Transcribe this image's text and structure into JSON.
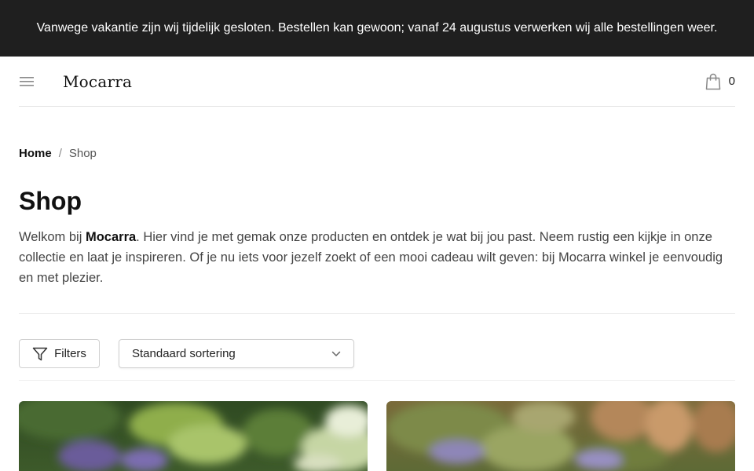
{
  "notice": {
    "text": "Vanwege vakantie zijn wij tijdelijk gesloten. Bestellen kan gewoon; vanaf 24 augustus verwerken wij alle bestellingen weer."
  },
  "header": {
    "logo": "Mocarra",
    "menu_icon": "hamburger-menu-icon",
    "cart_icon": "shopping-bag-icon",
    "cart_count": "0"
  },
  "breadcrumb": {
    "home": "Home",
    "separator": "/",
    "current": "Shop"
  },
  "page": {
    "title": "Shop",
    "intro_before": "Welkom bij ",
    "intro_brand": "Mocarra",
    "intro_after": ". Hier vind je met gemak onze producten en ontdek je wat bij jou past. Neem rustig een kijkje in onze collectie en laat je inspireren. Of je nu iets voor jezelf zoekt of een mooi cadeau wilt geven: bij Mocarra winkel je eenvoudig en met plezier."
  },
  "toolbar": {
    "filters_label": "Filters",
    "filters_icon": "funnel-icon",
    "sort_selected": "Standaard sortering",
    "sort_icon": "chevron-down-icon"
  },
  "colors": {
    "notice_bg": "#1f1f1f",
    "text": "#1f2328",
    "border": "#d0d0d0"
  }
}
